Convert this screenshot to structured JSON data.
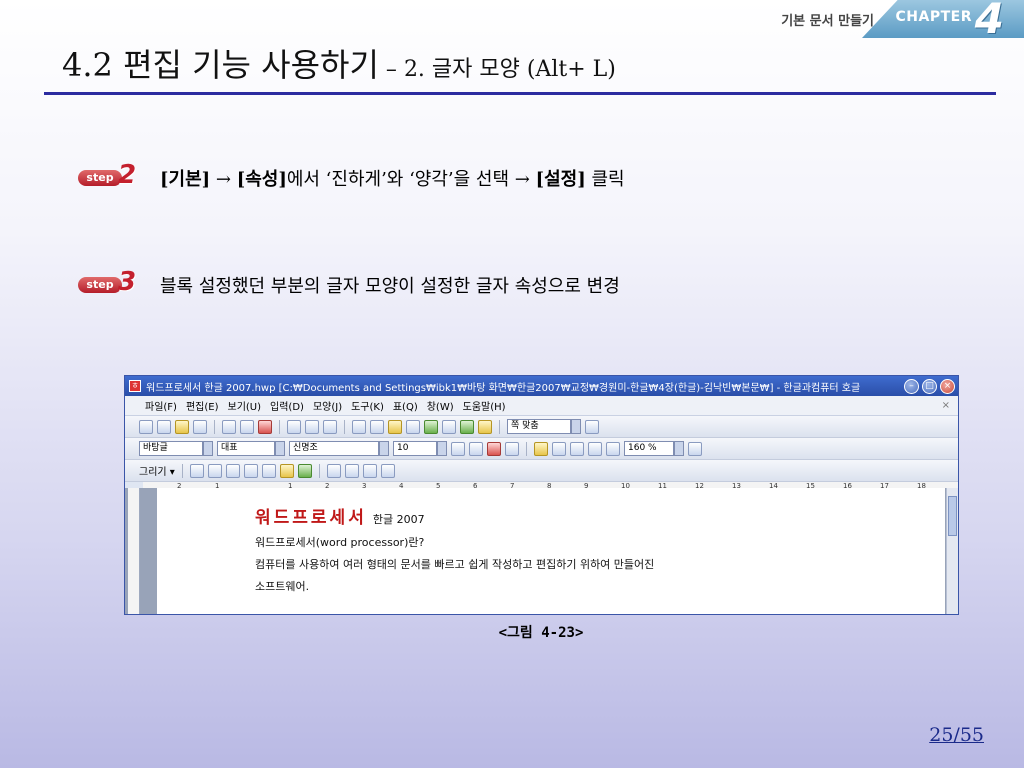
{
  "header": {
    "breadcrumb": "기본 문서 만들기",
    "chapter_label": "CHAPTER",
    "chapter_number": "4"
  },
  "title": {
    "main": "4.2 편집 기능 사용하기",
    "dash": " – ",
    "sub": "2. 글자 모양 (Alt+ L)"
  },
  "steps": [
    {
      "badge": "step",
      "number": "2",
      "part1_bold": "[기본]",
      "arrow1": " → ",
      "part2_bold": "[속성]",
      "part3": "에서 ‘진하게’와 ‘양각’을 선택 ",
      "arrow2": "→ ",
      "part4_bold": "[설정]",
      "part5": " 클릭"
    },
    {
      "badge": "step",
      "number": "3",
      "text": "블록 설정했던 부분의 글자 모양이 설정한 글자 속성으로 변경"
    }
  ],
  "app": {
    "window_title": "워드프로세서 한글 2007.hwp [C:₩Documents and Settings₩ibk1₩바탕 화면₩한글2007₩교정₩경원미-한글₩4장(한글)-김낙빈₩본문₩] - 한글과컴퓨터 호글",
    "menu": [
      "파일(F)",
      "편집(E)",
      "보기(U)",
      "입력(D)",
      "모양(J)",
      "도구(K)",
      "표(Q)",
      "창(W)",
      "도움말(H)"
    ],
    "menu_close": "×",
    "zoom": "쪽 맞춤",
    "style_combo": "바탕글",
    "lang_combo": "대표",
    "font_combo": "신명조",
    "size_combo": "10",
    "line_spacing": "160 %",
    "draw_label": "그리기 ▾",
    "ruler_marks": [
      "2",
      "1",
      "1",
      "2",
      "3",
      "4",
      "5",
      "6",
      "7",
      "8",
      "9",
      "10",
      "11",
      "12",
      "13",
      "14",
      "15",
      "16",
      "17",
      "18"
    ],
    "doc": {
      "heading": "워드프로세서",
      "heading_sub": "한글 2007",
      "line1": "워드프로세서(word processor)란?",
      "line2": "컴퓨터를 사용하여 여러 형태의 문서를 빠르고 쉽게 작성하고 편집하기 위하여 만들어진",
      "line3": "소프트웨어."
    }
  },
  "caption": "<그림 4-23>",
  "page_number": "25/55",
  "colors": {
    "title_rule": "#2b2ba0",
    "step_badge": "#c4202e",
    "doc_heading": "#c01818",
    "page_number": "#1a2a8a"
  }
}
